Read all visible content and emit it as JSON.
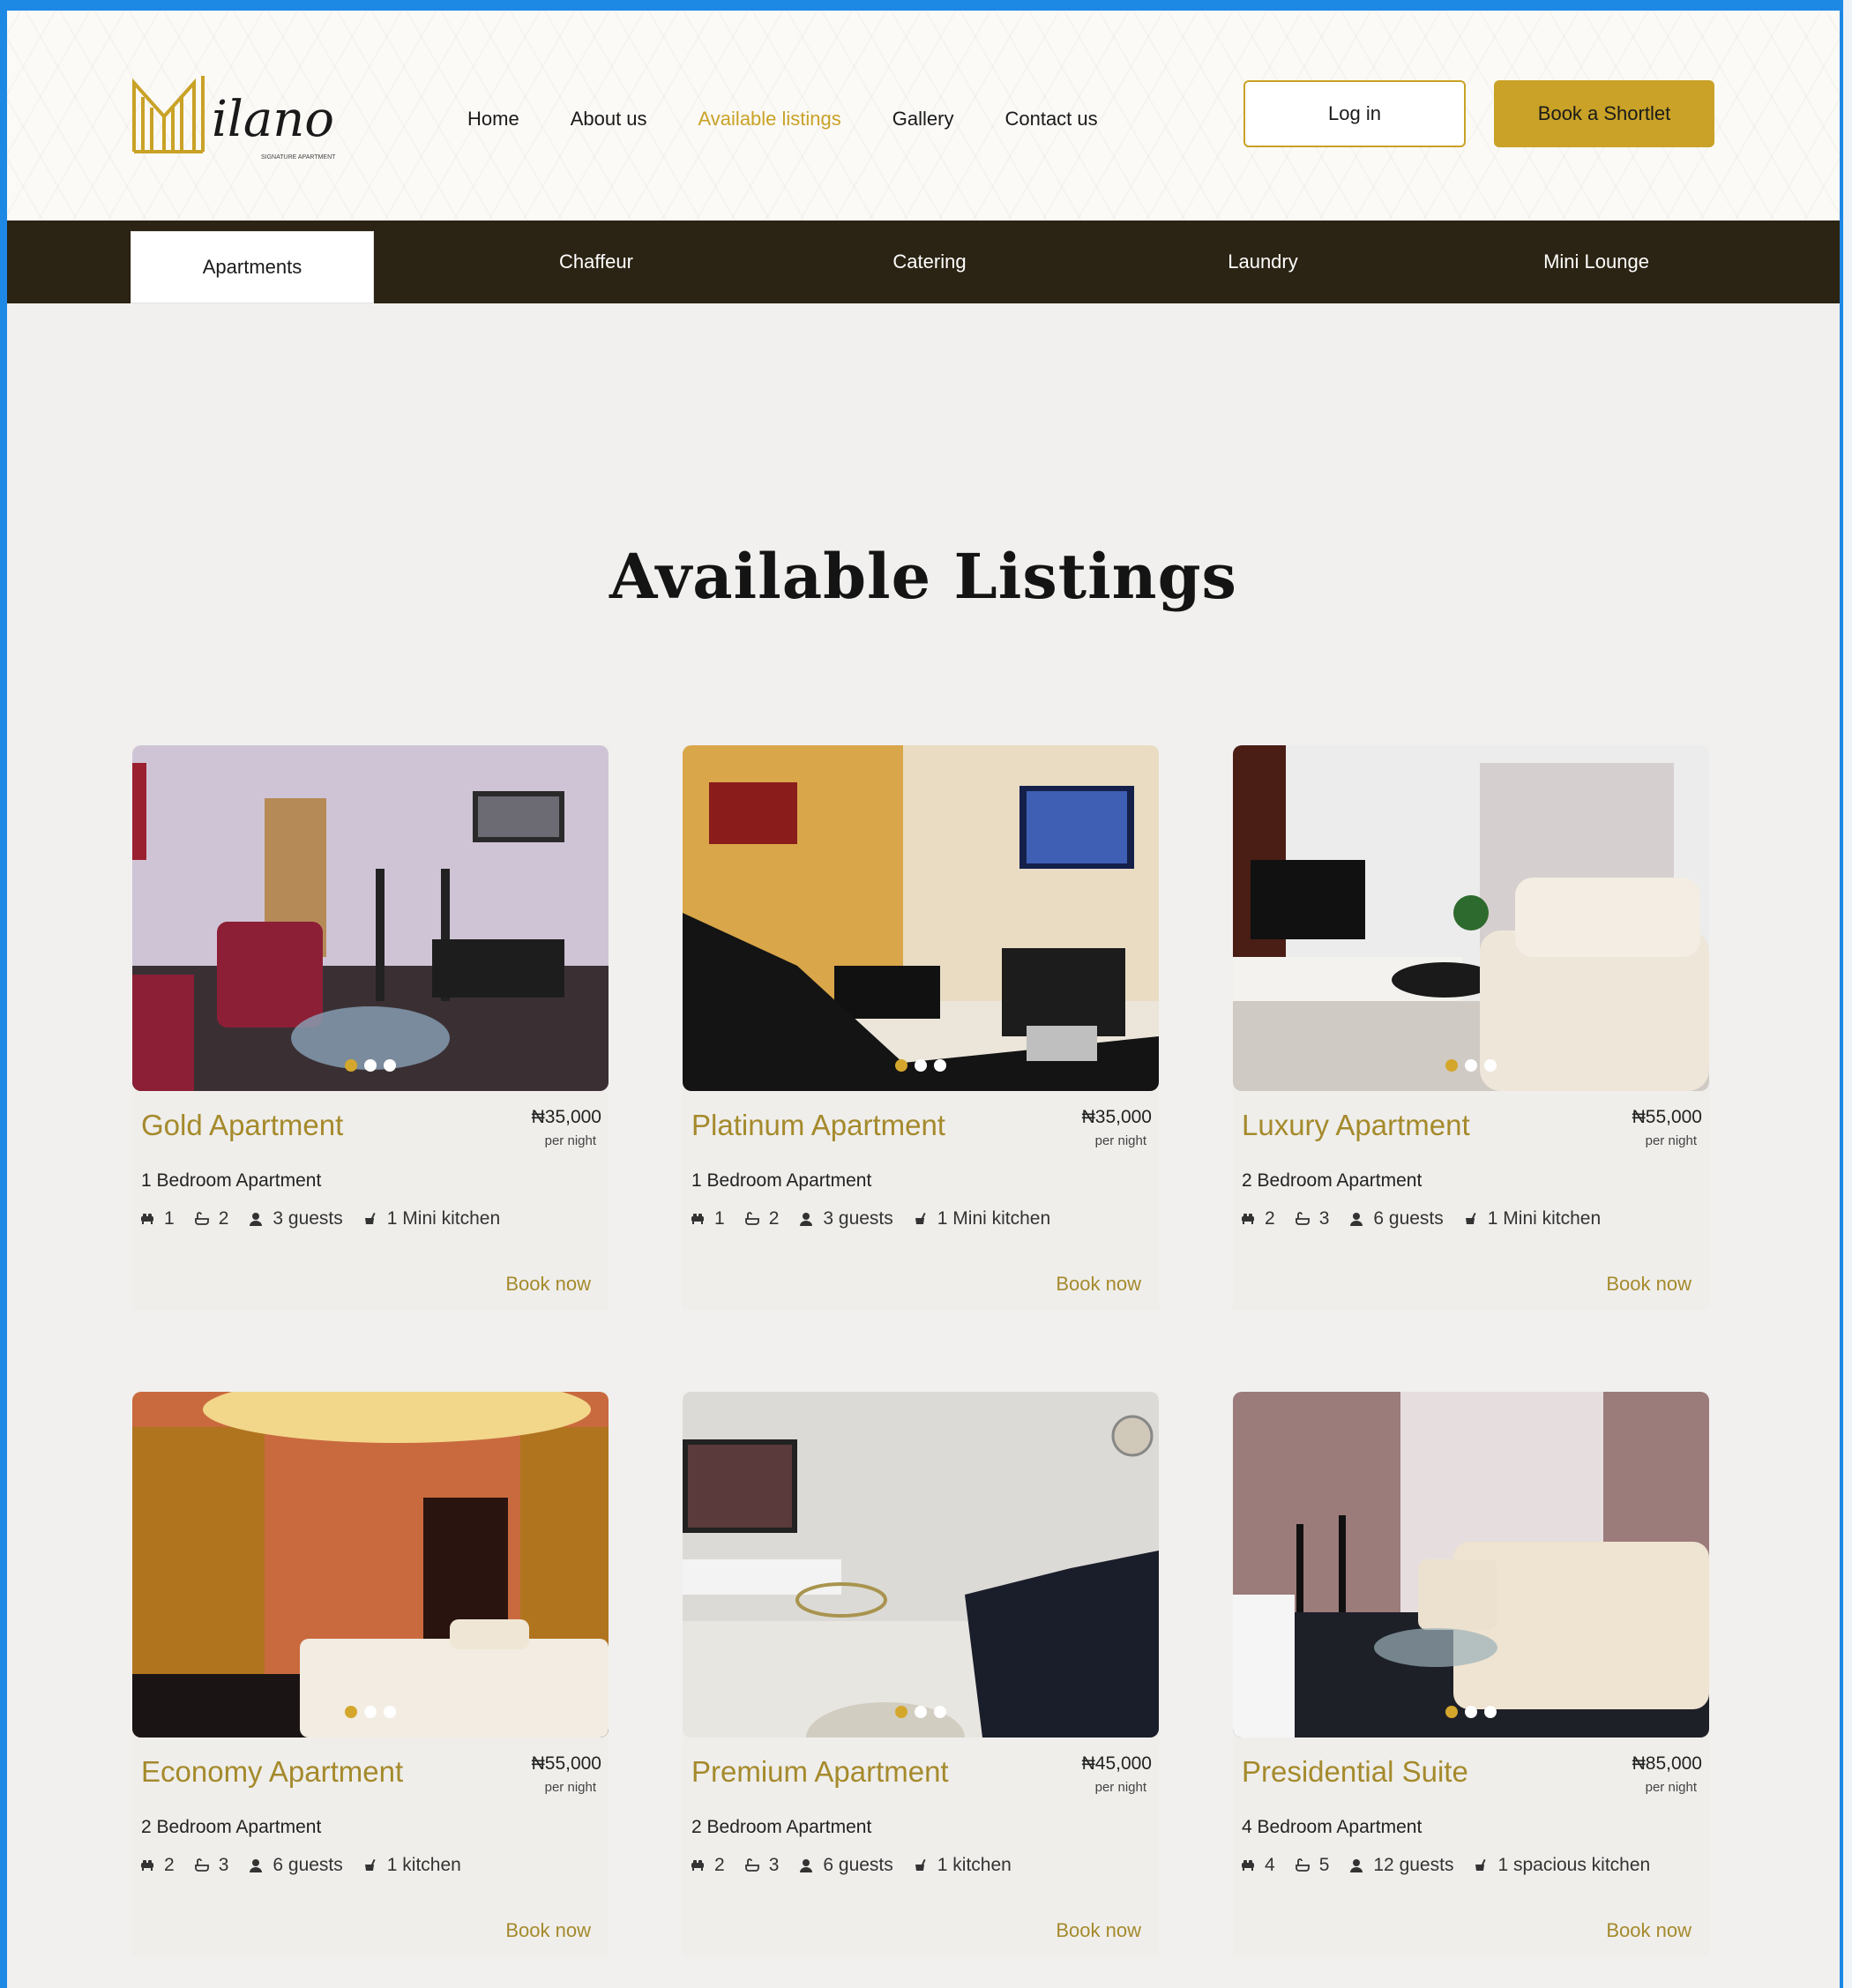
{
  "brand": {
    "name": "Milano",
    "tagline": "SIGNATURE APARTMENT",
    "accent": "#c9a227",
    "dark": "#2b2313"
  },
  "nav": {
    "items": [
      "Home",
      "About us",
      "Available listings",
      "Gallery",
      "Contact us"
    ],
    "active_index": 2
  },
  "actions": {
    "login": "Log in",
    "book": "Book a Shortlet"
  },
  "categories": [
    "Apartments",
    "Chaffeur",
    "Catering",
    "Laundry",
    "Mini Lounge"
  ],
  "category_active": 0,
  "page": {
    "title": "Available Listings"
  },
  "listings": [
    {
      "title": "Gold Apartment",
      "price": "₦35,000",
      "per": "per night",
      "type": "1 Bedroom Apartment",
      "beds": "1",
      "baths": "2",
      "guests": "3 guests",
      "kitchen": "1 Mini kitchen",
      "cta": "Book now"
    },
    {
      "title": "Platinum Apartment",
      "price": "₦35,000",
      "per": "per night",
      "type": "1 Bedroom Apartment",
      "beds": "1",
      "baths": "2",
      "guests": "3 guests",
      "kitchen": "1 Mini kitchen",
      "cta": "Book now"
    },
    {
      "title": "Luxury Apartment",
      "price": "₦55,000",
      "per": "per night",
      "type": "2 Bedroom Apartment",
      "beds": "2",
      "baths": "3",
      "guests": "6 guests",
      "kitchen": "1 Mini kitchen",
      "cta": "Book now"
    },
    {
      "title": "Economy Apartment",
      "price": "₦55,000",
      "per": "per night",
      "type": "2 Bedroom Apartment",
      "beds": "2",
      "baths": "3",
      "guests": "6 guests",
      "kitchen": "1 kitchen",
      "cta": "Book now"
    },
    {
      "title": "Premium Apartment",
      "price": "₦45,000",
      "per": "per night",
      "type": "2 Bedroom Apartment",
      "beds": "2",
      "baths": "3",
      "guests": "6 guests",
      "kitchen": "1  kitchen",
      "cta": "Book now"
    },
    {
      "title": "Presidential Suite",
      "price": "₦85,000",
      "per": "per night",
      "type": "4 Bedroom Apartment",
      "beds": "4",
      "baths": "5",
      "guests": "12 guests",
      "kitchen": "1 spacious kitchen",
      "cta": "Book now"
    }
  ]
}
